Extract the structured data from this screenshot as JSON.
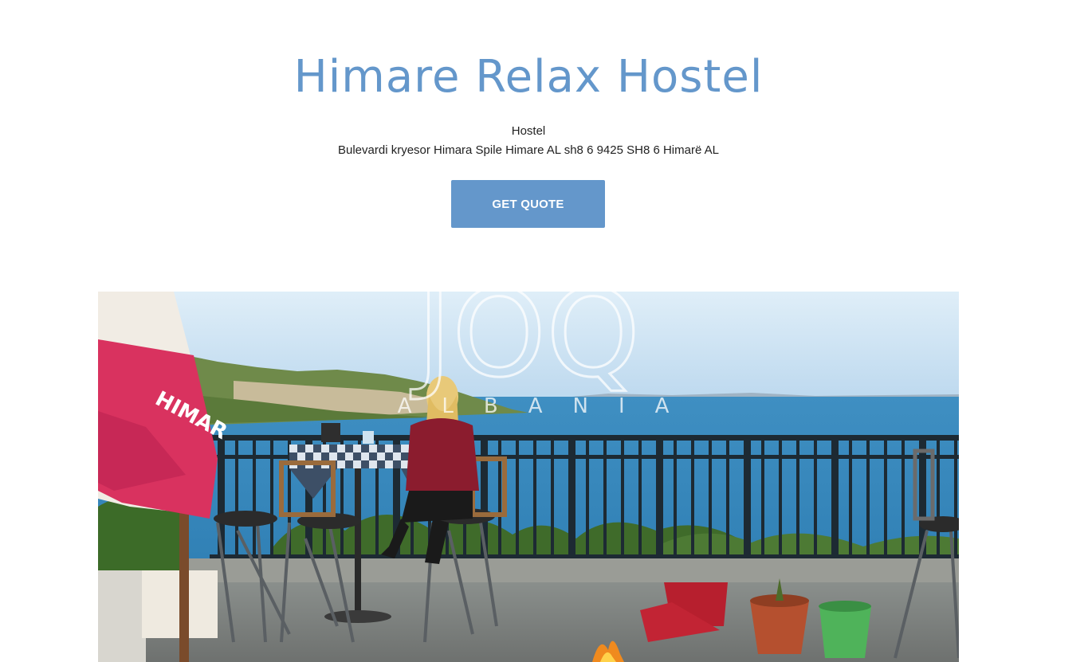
{
  "header": {
    "title": "Himare Relax Hostel",
    "category": "Hostel",
    "address": "Bulevardi kryesor Himara Spile Himare AL sh8 6 9425 SH8 6 Himarë AL"
  },
  "actions": {
    "quote_label": "GET QUOTE"
  },
  "photo": {
    "watermark_logo": "JOQ",
    "watermark_sub": "ALBANIA",
    "umbrella_text": "HIMAR"
  },
  "colors": {
    "accent": "#6497cb",
    "text": "#222222",
    "background": "#ffffff"
  }
}
